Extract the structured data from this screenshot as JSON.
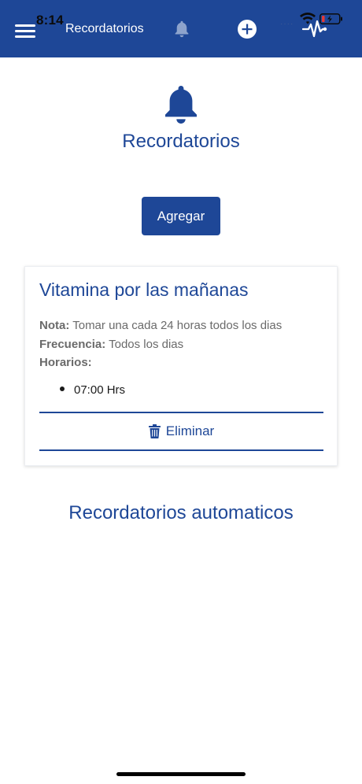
{
  "status_bar": {
    "time": "8:14",
    "dots": "····"
  },
  "header": {
    "title": "Recordatorios"
  },
  "page": {
    "title": "Recordatorios",
    "add_button": "Agregar"
  },
  "reminder": {
    "title": "Vitamina por las mañanas",
    "nota_label": "Nota:",
    "nota_value": " Tomar una cada 24 horas todos los dias",
    "frecuencia_label": "Frecuencia:",
    "frecuencia_value": " Todos los dias",
    "horarios_label": "Horarios:",
    "times": [
      "07:00 Hrs"
    ],
    "delete_label": "Eliminar"
  },
  "section": {
    "title": "Recordatorios automaticos"
  },
  "colors": {
    "primary": "#1e4797",
    "muted_text": "#6a6a6a",
    "background": "#ffffff"
  },
  "icons": [
    "menu-icon",
    "bell-icon",
    "plus-circle-icon",
    "heartbeat-icon",
    "trash-icon",
    "wifi-icon",
    "battery-icon"
  ]
}
